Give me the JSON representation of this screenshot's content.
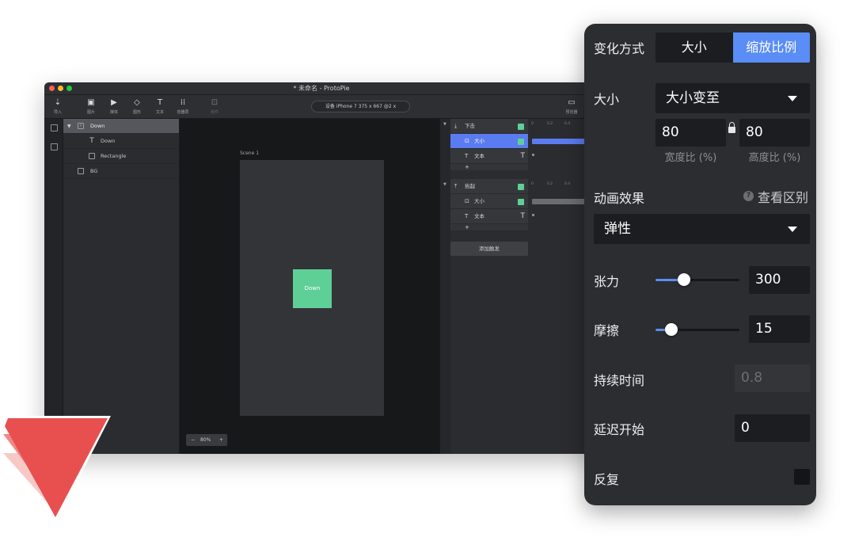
{
  "window": {
    "title": "* 未命名 - ProtoPie",
    "toolbar": [
      {
        "icon": "import-icon",
        "glyph": "⇣",
        "label": "导入"
      },
      {
        "icon": "image-icon",
        "glyph": "▣",
        "label": "图片"
      },
      {
        "icon": "media-icon",
        "glyph": "▶",
        "label": "媒体"
      },
      {
        "icon": "shape-icon",
        "glyph": "◇",
        "label": "图形"
      },
      {
        "icon": "text-icon",
        "glyph": "T",
        "label": "文本"
      },
      {
        "icon": "container-icon",
        "glyph": "⁞⁞",
        "label": "容器层"
      },
      {
        "icon": "component-icon",
        "glyph": "⊡",
        "label": "组件"
      }
    ],
    "device": "设备   iPhone 7  375 x 667  @2 x",
    "preview_label": "预览器"
  },
  "layers": [
    {
      "name": "Down",
      "type": "container",
      "selected": true
    },
    {
      "name": "Down",
      "type": "text"
    },
    {
      "name": "Rectangle",
      "type": "rect"
    },
    {
      "name": "BG",
      "type": "rect"
    }
  ],
  "canvas": {
    "scene_label": "Scene 1",
    "button_label": "Down",
    "zoom": "80%",
    "zoom_minus": "−",
    "zoom_plus": "+"
  },
  "timeline": {
    "triggers": [
      {
        "name": "下击",
        "responses": [
          {
            "name": "大小",
            "selected": true
          },
          {
            "name": "文本"
          }
        ]
      },
      {
        "name": "抬起",
        "responses": [
          {
            "name": "大小"
          },
          {
            "name": "文本"
          }
        ]
      }
    ],
    "ruler": [
      "0",
      "0.2",
      "0.4"
    ],
    "add_trigger": "添加触发",
    "plus": "+",
    "text_glyph": "T"
  },
  "panel": {
    "change_mode": {
      "label": "变化方式",
      "options": [
        "大小",
        "缩放比例"
      ],
      "selected": 1
    },
    "size": {
      "label": "大小",
      "dropdown": "大小变至",
      "width": "80",
      "height": "80",
      "width_caption": "宽度比 (%)",
      "height_caption": "高度比 (%)"
    },
    "animation": {
      "label": "动画效果",
      "help": "查看区别",
      "help_glyph": "?",
      "dropdown": "弹性"
    },
    "tension": {
      "label": "张力",
      "value": "300",
      "slider_level": 0.34
    },
    "friction": {
      "label": "摩擦",
      "value": "15",
      "slider_level": 0.19
    },
    "duration": {
      "label": "持续时间",
      "value": "0.8"
    },
    "delay": {
      "label": "延迟开始",
      "value": "0"
    },
    "repeat": {
      "label": "反复"
    }
  },
  "colors": {
    "accent": "#5a8df5",
    "green": "#5fcf98",
    "logo": "#e8504f"
  }
}
